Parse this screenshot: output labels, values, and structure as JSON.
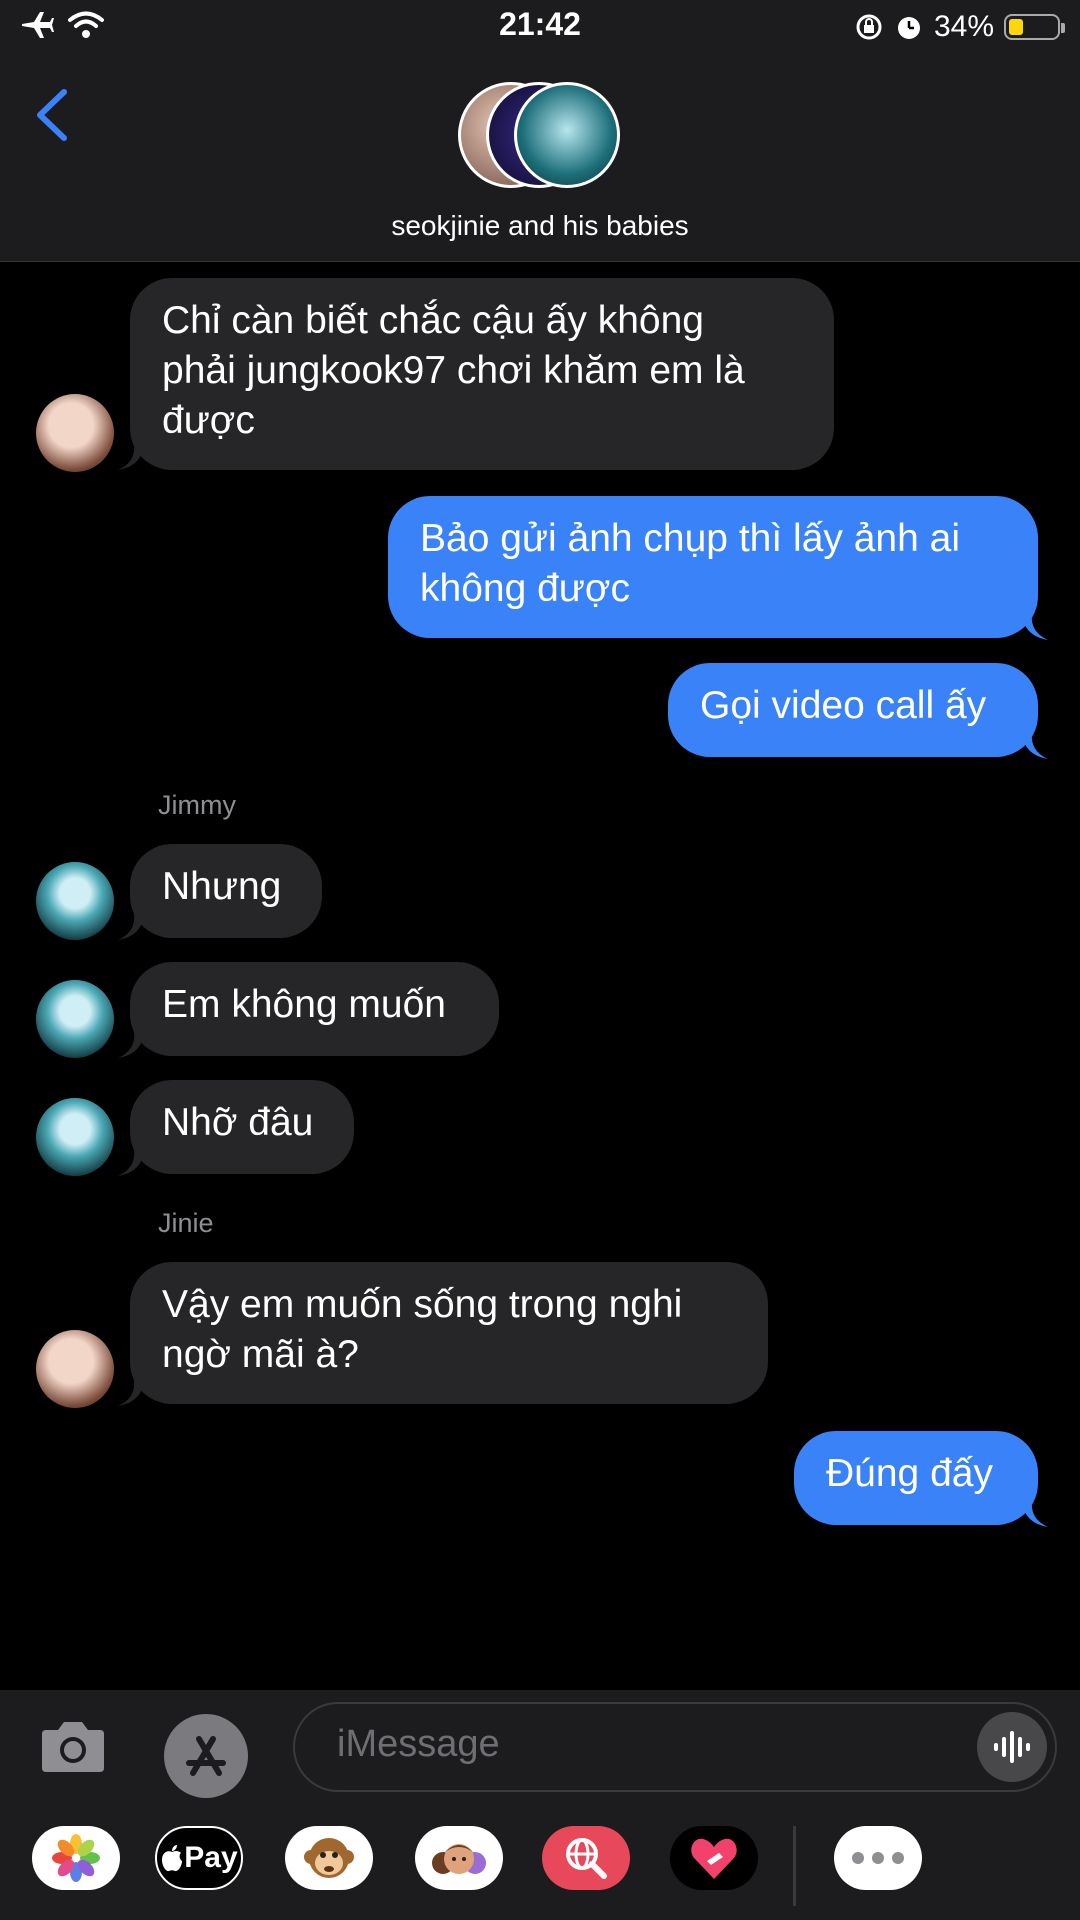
{
  "status_bar": {
    "time": "21:42",
    "battery": "34%"
  },
  "header": {
    "group_name": "seokjinie and his babies"
  },
  "messages": [
    {
      "from": "Jinie",
      "direction": "in",
      "text": "Chỉ càn biết chắc cậu ấy không\nphải jungkook97 chơi khăm em là\nđược"
    },
    {
      "from": "me",
      "direction": "out",
      "text": "Bảo gửi ảnh chụp thì lấy ảnh ai\nkhông được"
    },
    {
      "from": "me",
      "direction": "out",
      "text": "Gọi video call ấy"
    },
    {
      "sender_label": "Jimmy"
    },
    {
      "from": "Jimmy",
      "direction": "in",
      "text": "Nhưng"
    },
    {
      "from": "Jimmy",
      "direction": "in",
      "text": "Em không muốn"
    },
    {
      "from": "Jimmy",
      "direction": "in",
      "text": "Nhỡ đâu"
    },
    {
      "sender_label": "Jinie"
    },
    {
      "from": "Jinie",
      "direction": "in",
      "text": "Vậy em muốn sống trong nghi\nngờ mãi à?"
    },
    {
      "from": "me",
      "direction": "out",
      "text": "Đúng đấy"
    }
  ],
  "composer": {
    "placeholder": "iMessage"
  },
  "app_tray": {
    "items": [
      "photos-app",
      "apple-pay",
      "animoji",
      "memoji",
      "image-search",
      "digital-touch",
      "more"
    ],
    "apple_pay_label": "Pay"
  },
  "colors": {
    "outgoing_bubble": "#3a82f7",
    "incoming_bubble": "#262628",
    "accent": "#3a82f7"
  }
}
